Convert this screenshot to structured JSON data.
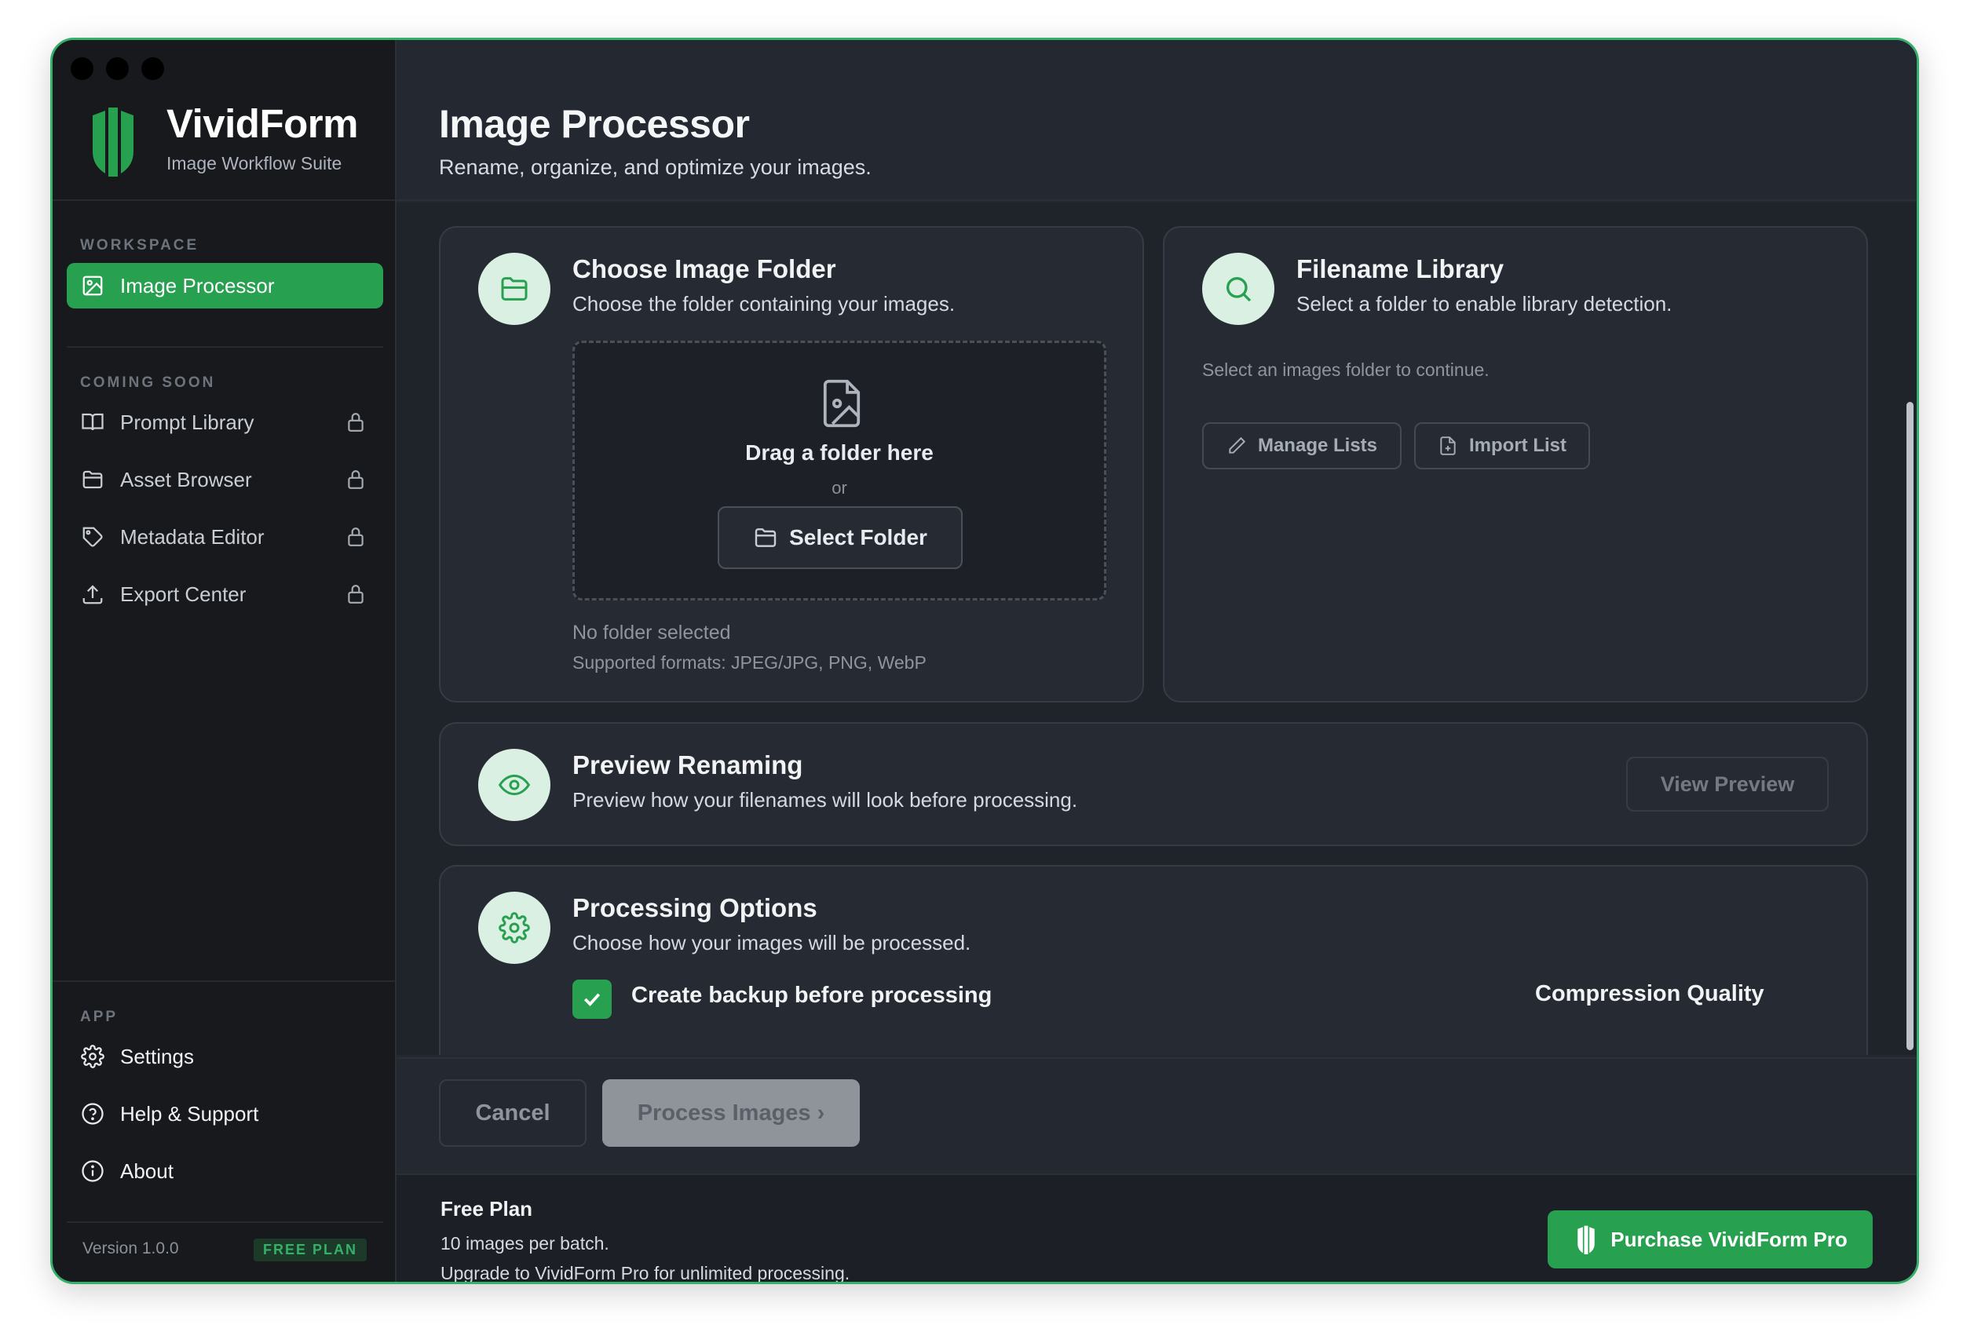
{
  "app": {
    "name": "VividForm",
    "tagline": "Image Workflow Suite"
  },
  "colors": {
    "accent": "#27a050",
    "window_border": "#35b06a",
    "sidebar_bg": "#17191d",
    "main_bg": "#232831",
    "card_bg": "#262b33",
    "icon_circle": "#d9f0e2"
  },
  "sidebar": {
    "workspace_label": "WORKSPACE",
    "workspace_items": [
      {
        "label": "Image Processor",
        "icon": "image-icon",
        "active": true
      }
    ],
    "coming_soon_label": "COMING SOON",
    "coming_soon_items": [
      {
        "label": "Prompt Library",
        "icon": "book-icon",
        "locked": true
      },
      {
        "label": "Asset Browser",
        "icon": "folder-icon",
        "locked": true
      },
      {
        "label": "Metadata Editor",
        "icon": "tag-icon",
        "locked": true
      },
      {
        "label": "Export Center",
        "icon": "upload-icon",
        "locked": true
      }
    ],
    "app_label": "APP",
    "app_items": [
      {
        "label": "Settings",
        "icon": "gear-icon"
      },
      {
        "label": "Help & Support",
        "icon": "help-icon"
      },
      {
        "label": "About",
        "icon": "info-icon"
      }
    ],
    "version": "Version 1.0.0",
    "plan_badge": "FREE PLAN"
  },
  "header": {
    "title": "Image Processor",
    "subtitle": "Rename, organize, and optimize your images."
  },
  "choose_folder": {
    "title": "Choose Image Folder",
    "subtitle": "Choose the folder containing your images.",
    "drop_text": "Drag a folder here",
    "or_text": "or",
    "select_button": "Select Folder",
    "status": "No folder selected",
    "formats": "Supported formats: JPEG/JPG, PNG, WebP"
  },
  "filename_library": {
    "title": "Filename Library",
    "subtitle": "Select a folder to enable library detection.",
    "hint": "Select an images folder to continue.",
    "manage_button": "Manage Lists",
    "import_button": "Import List"
  },
  "preview": {
    "title": "Preview Renaming",
    "subtitle": "Preview how your filenames will look before processing.",
    "button": "View Preview"
  },
  "processing": {
    "title": "Processing Options",
    "subtitle": "Choose how your images will be processed.",
    "backup_label": "Create backup before processing",
    "backup_checked": true,
    "compression_label": "Compression Quality"
  },
  "actions": {
    "cancel": "Cancel",
    "process": "Process Images ›"
  },
  "plan": {
    "title": "Free Plan",
    "line1": "10 images per batch.",
    "line2": "Upgrade to VividForm Pro for unlimited processing.",
    "purchase_button": "Purchase VividForm Pro"
  }
}
